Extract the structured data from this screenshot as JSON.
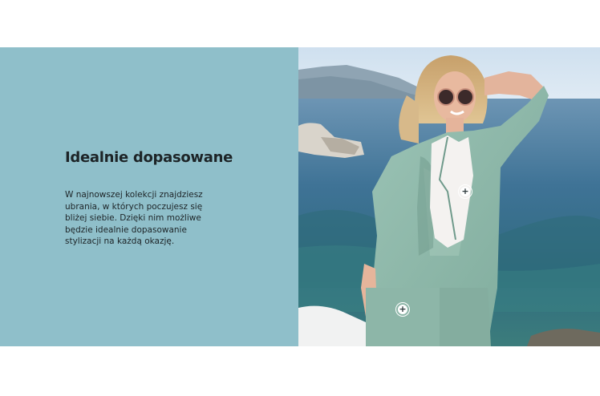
{
  "banner": {
    "title": "Idealnie dopasowane",
    "description": "W najnowszej kolekcji znajdziesz ubrania, w których poczujesz się bliżej siebie. Dzięki nim możliwe będzie idealnie dopasowanie stylizacji na każdą okazję.",
    "panel_color": "#8fbfca"
  },
  "photo": {
    "hotspots": [
      {
        "name": "shirt",
        "icon": "plus-icon",
        "symbol": "+"
      },
      {
        "name": "trousers",
        "icon": "plus-icon",
        "symbol": "+"
      }
    ]
  }
}
